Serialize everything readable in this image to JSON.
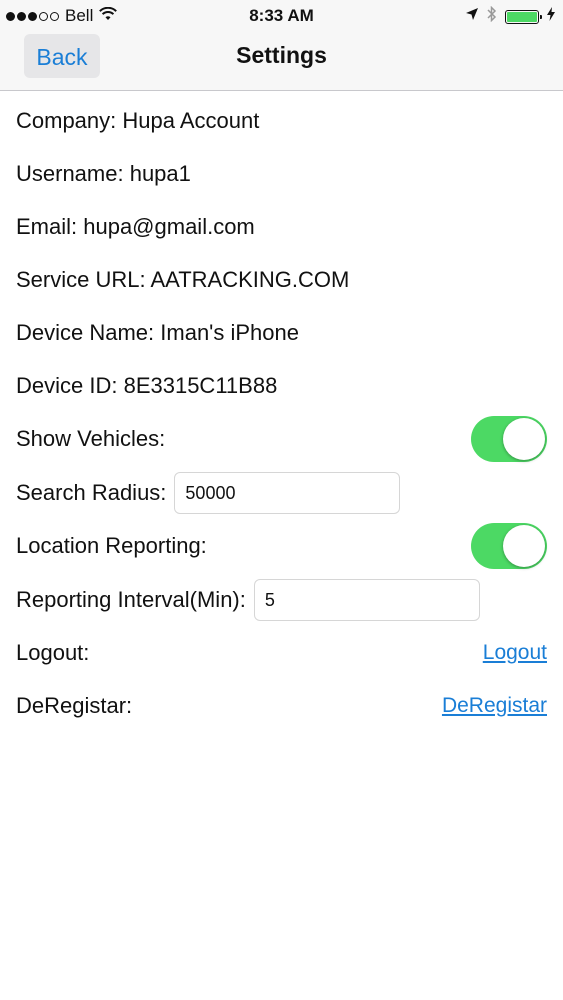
{
  "status_bar": {
    "carrier": "Bell",
    "time": "8:33 AM",
    "icons": [
      "signal-dots-icon",
      "wifi-icon",
      "location-arrow-icon",
      "bluetooth-icon",
      "battery-icon",
      "charging-bolt-icon"
    ]
  },
  "nav": {
    "back_label": "Back",
    "title": "Settings"
  },
  "info": {
    "company": "Company: Hupa Account",
    "username": "Username: hupa1",
    "email": "Email: hupa@gmail.com",
    "service_url": "Service URL: AATRACKING.COM",
    "device_name": "Device Name: Iman's iPhone",
    "device_id": "Device ID: 8E3315C11B88"
  },
  "settings": {
    "show_vehicles_label": "Show Vehicles:",
    "show_vehicles_on": true,
    "search_radius_label": "Search Radius:",
    "search_radius_value": "50000",
    "location_reporting_label": "Location Reporting:",
    "location_reporting_on": true,
    "reporting_interval_label": "Reporting Interval(Min):",
    "reporting_interval_value": "5",
    "logout_label": "Logout:",
    "logout_link": "Logout",
    "deregister_label": "DeRegistar:",
    "deregister_link": "DeRegistar"
  },
  "colors": {
    "accent": "#1a7ed6",
    "toggle_on": "#4cd964"
  }
}
